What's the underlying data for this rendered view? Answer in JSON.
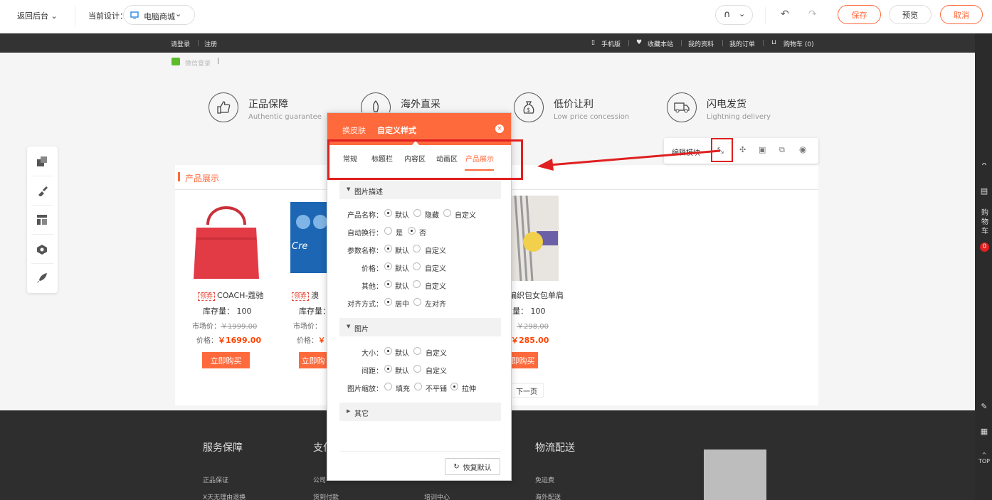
{
  "topbar": {
    "back_label": "返回后台",
    "current_design_label": "当前设计：",
    "design_select": "电脑商城",
    "save_label": "保存",
    "preview_label": "预览",
    "cancel_label": "取消"
  },
  "site_nav": {
    "login": "请登录",
    "register": "注册",
    "wechat_login": "微信登录",
    "mobile": "手机版",
    "favorite": "收藏本站",
    "my_profile": "我的资料",
    "my_orders": "我的订单",
    "cart": "购物车 (0)"
  },
  "guarantees": [
    {
      "title": "正品保障",
      "subtitle": "Authentic guarantee",
      "icon": "thumbs-up-icon"
    },
    {
      "title": "海外直采",
      "subtitle": "",
      "icon": "rocket-icon"
    },
    {
      "title": "低价让利",
      "subtitle": "Low price concession",
      "icon": "money-bag-icon"
    },
    {
      "title": "闪电发货",
      "subtitle": "Lightning delivery",
      "icon": "truck-icon"
    }
  ],
  "module_bar": {
    "edit_label": "编辑模块"
  },
  "section_title": "产品展示",
  "products": [
    {
      "tag": "领券",
      "name": "COACH-蔻驰",
      "stock": "库存量： 100",
      "market_label": "市场价：",
      "market_price": "￥1999.00",
      "price_label": "价格：",
      "price": "￥1699.00",
      "buy": "立即购买"
    },
    {
      "tag": "领券",
      "name": "澳",
      "stock": "库存量：",
      "market_label": "市场价：",
      "market_price": "",
      "price_label": "价格：",
      "price": "￥",
      "buy": "立即购"
    },
    {
      "tag": "",
      "name": "编织包女包单肩",
      "stock": "量： 100",
      "market_label": "",
      "market_price": "￥298.00",
      "price_label": "",
      "price": "￥285.00",
      "buy": "即购买"
    }
  ],
  "pager_next": "下一页",
  "dialog": {
    "head_tab_1": "换皮肤",
    "head_tab_2": "自定义样式",
    "tabs": [
      "常规",
      "标题栏",
      "内容区",
      "动画区",
      "产品展示"
    ],
    "active_tab": "产品展示",
    "sec_desc": "图片描述",
    "sec_image": "图片",
    "sec_other": "其它",
    "rows": {
      "product_name": {
        "label": "产品名称：",
        "options": [
          "默认",
          "隐藏",
          "自定义"
        ],
        "selected": "默认"
      },
      "auto_wrap": {
        "label": "自动换行：",
        "options": [
          "是",
          "否"
        ],
        "selected": "否"
      },
      "param_name": {
        "label": "参数名称：",
        "options": [
          "默认",
          "自定义"
        ],
        "selected": "默认"
      },
      "price": {
        "label": "价格：",
        "options": [
          "默认",
          "自定义"
        ],
        "selected": "默认"
      },
      "other": {
        "label": "其他：",
        "options": [
          "默认",
          "自定义"
        ],
        "selected": "默认"
      },
      "align": {
        "label": "对齐方式：",
        "options": [
          "居中",
          "左对齐"
        ],
        "selected": "居中"
      },
      "size": {
        "label": "大小：",
        "options": [
          "默认",
          "自定义"
        ],
        "selected": "默认"
      },
      "spacing": {
        "label": "间距：",
        "options": [
          "默认",
          "自定义"
        ],
        "selected": "默认"
      },
      "scale": {
        "label": "图片缩放：",
        "options": [
          "填充",
          "不平铺",
          "拉伸"
        ],
        "selected": "拉伸"
      }
    },
    "restore_label": "恢复默认"
  },
  "footer": {
    "cols": [
      {
        "title": "服务保障",
        "links": [
          "正品保证",
          "X天无理由退换"
        ]
      },
      {
        "title": "支付",
        "links": [
          "公司",
          "货到付款"
        ]
      },
      {
        "title": "",
        "links": [
          "",
          "培训中心"
        ]
      },
      {
        "title": "物流配送",
        "links": [
          "免运费",
          "海外配送"
        ]
      }
    ]
  },
  "right_rail": {
    "cart_text": "购物车",
    "cart_count": "0",
    "top_label": "TOP"
  },
  "colors": {
    "accent": "#ff6a3c",
    "highlight": "#e02020",
    "price": "#ff4400"
  }
}
